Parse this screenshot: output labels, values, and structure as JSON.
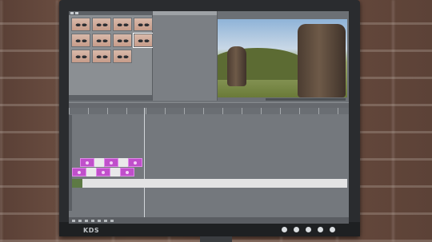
{
  "device": {
    "brand": "KDS",
    "hardware_buttons": [
      "power",
      "menu",
      "up",
      "down",
      "select"
    ]
  },
  "app": {
    "thumbnail_panel": {
      "selected_index": 7,
      "items": [
        "eye-preset-1",
        "eye-preset-2",
        "eye-preset-3",
        "eye-preset-4",
        "eye-preset-5",
        "eye-preset-6",
        "eye-preset-7",
        "eye-preset-8",
        "eye-preset-9",
        "eye-preset-10",
        "eye-preset-11"
      ]
    },
    "preview": {
      "subject_icon": "moai-statues-image"
    },
    "timeline": {
      "track1_clips": 3,
      "track2_clips": 4
    }
  },
  "colors": {
    "clip": "#c04fcb",
    "clip_border": "#e189ea",
    "bezel": "#2a2c2f",
    "timeline_bg": "#74787d"
  }
}
